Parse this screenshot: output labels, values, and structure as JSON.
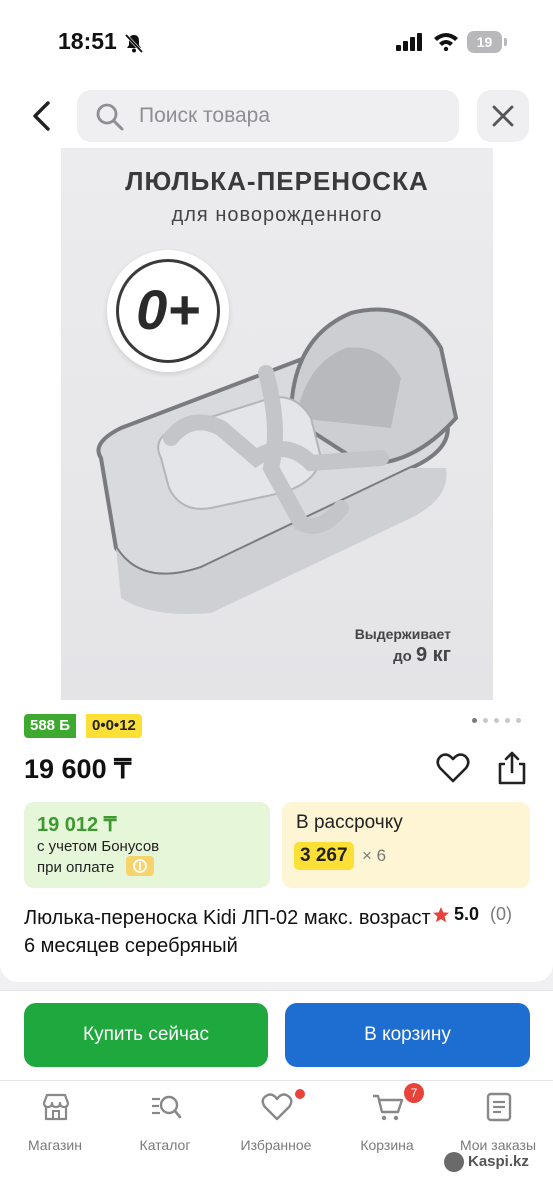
{
  "status": {
    "time": "18:51",
    "battery": "19"
  },
  "search": {
    "placeholder": "Поиск товара"
  },
  "image": {
    "title": "ЛЮЛЬКА-ПЕРЕНОСКА",
    "subtitle": "для новорожденного",
    "age": "0+",
    "capacity_line1": "Выдерживает",
    "capacity_line2_prefix": "до ",
    "capacity_line2_value": "9 кг",
    "gallery_dots": 5,
    "gallery_active": 0
  },
  "badges": {
    "bonus": "588 Б",
    "installment": "0•0•12"
  },
  "product": {
    "price": "19 600 ₸",
    "name": "Люлька-переноска Kidi ЛП-02 макс. возраст 6 месяцев серебряный",
    "rating": "5.0",
    "reviews": "(0)"
  },
  "bonus_card": {
    "price": "19 012 ₸",
    "note_line1": "с учетом Бонусов",
    "note_line2": "при оплате"
  },
  "install_card": {
    "title": "В рассрочку",
    "amount": "3 267",
    "multiplier": "× 6"
  },
  "actions": {
    "buy": "Купить сейчас",
    "cart": "В корзину"
  },
  "nav": [
    {
      "label": "Магазин",
      "icon": "shop-icon"
    },
    {
      "label": "Каталог",
      "icon": "catalog-icon"
    },
    {
      "label": "Избранное",
      "icon": "heart-icon"
    },
    {
      "label": "Корзина",
      "icon": "cart-icon",
      "count": "7"
    },
    {
      "label": "Мои заказы",
      "icon": "orders-icon"
    }
  ],
  "watermark": "Kaspi.kz",
  "colors": {
    "green": "#1fa83d",
    "blue": "#1e6ed2",
    "yellow": "#fde036",
    "badge_red": "#e8433a",
    "rating_star": "#e8433a"
  }
}
